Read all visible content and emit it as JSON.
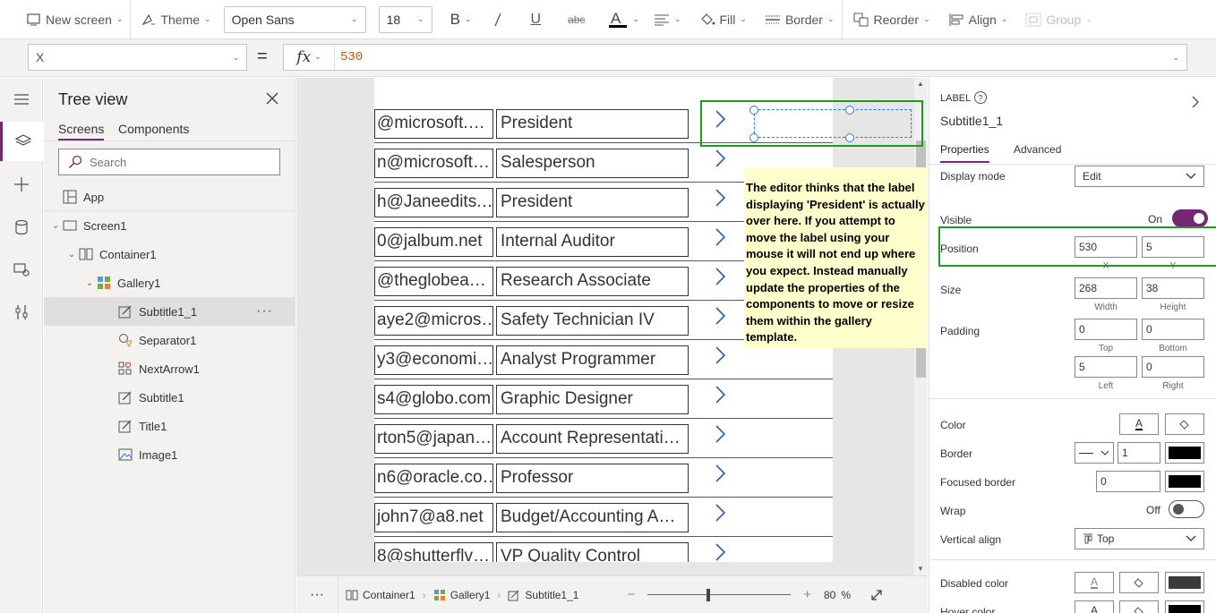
{
  "toolbar": {
    "new_screen": "New screen",
    "theme": "Theme",
    "font": "Open Sans",
    "font_size": "18",
    "fill": "Fill",
    "border": "Border",
    "reorder": "Reorder",
    "align": "Align",
    "group": "Group"
  },
  "formula": {
    "property": "X",
    "equals": "=",
    "fx": "fx",
    "value": "530"
  },
  "tree": {
    "title": "Tree view",
    "tabs": [
      "Screens",
      "Components"
    ],
    "search_placeholder": "Search",
    "items": [
      "App",
      "Screen1",
      "Container1",
      "Gallery1",
      "Subtitle1_1",
      "Separator1",
      "NextArrow1",
      "Subtitle1",
      "Title1",
      "Image1"
    ],
    "more": "···"
  },
  "gallery": {
    "rows": [
      {
        "email": "@microsoft.…",
        "title": "President"
      },
      {
        "email": "n@microsoft…",
        "title": "Salesperson"
      },
      {
        "email": "h@Janeedits.…",
        "title": "President"
      },
      {
        "email": "0@jalbum.net",
        "title": "Internal Auditor"
      },
      {
        "email": "@theglobea…",
        "title": "Research Associate"
      },
      {
        "email": "aye2@micros…",
        "title": "Safety Technician IV"
      },
      {
        "email": "y3@economi…",
        "title": "Analyst Programmer"
      },
      {
        "email": "s4@globo.com",
        "title": "Graphic Designer"
      },
      {
        "email": "rton5@japan…",
        "title": "Account Representati…"
      },
      {
        "email": "n6@oracle.co…",
        "title": "Professor"
      },
      {
        "email": "john7@a8.net",
        "title": "Budget/Accounting A…"
      },
      {
        "email": "8@shutterflv…",
        "title": "VP Quality Control"
      }
    ]
  },
  "callout": {
    "text": "The editor thinks that the label displaying 'President' is actually over here.  If you attempt to move the label using your mouse it will not end up where you expect. Instead manually update the properties of the components to move or resize them within the gallery template."
  },
  "statusbar": {
    "more": "···",
    "crumbs": [
      "Container1",
      "Gallery1",
      "Subtitle1_1"
    ],
    "zoom_minus": "−",
    "zoom_plus": "+",
    "zoom_value": "80",
    "zoom_unit": "%",
    "zoom_level": 0.8
  },
  "props": {
    "type": "LABEL",
    "name": "Subtitle1_1",
    "tabs": [
      "Properties",
      "Advanced"
    ],
    "display_mode_label": "Display mode",
    "display_mode": "Edit",
    "visible_label": "Visible",
    "visible_state": "On",
    "position_label": "Position",
    "position_x": "530",
    "position_y": "5",
    "x_label": "X",
    "y_label": "Y",
    "size_label": "Size",
    "width": "268",
    "height": "38",
    "width_label": "Width",
    "height_label": "Height",
    "padding_label": "Padding",
    "pad_top": "0",
    "pad_bottom": "0",
    "pad_left": "5",
    "pad_right": "0",
    "top_label": "Top",
    "bottom_label": "Bottom",
    "left_label": "Left",
    "right_label": "Right",
    "color_label": "Color",
    "color_glyph": "A",
    "border_label": "Border",
    "border_width": "1",
    "focused_border_label": "Focused border",
    "focused_border_width": "0",
    "wrap_label": "Wrap",
    "wrap_state": "Off",
    "valign_label": "Vertical align",
    "valign": "Top",
    "disabled_color_label": "Disabled color",
    "hover_color_label": "Hover color",
    "accent": "#742774",
    "border_color": "#000000"
  }
}
